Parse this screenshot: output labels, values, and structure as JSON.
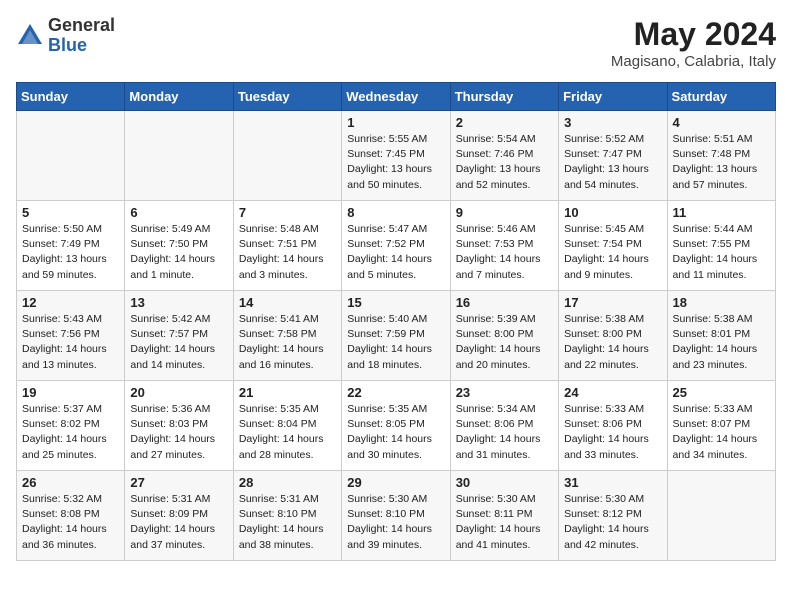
{
  "header": {
    "logo": {
      "text_general": "General",
      "text_blue": "Blue"
    },
    "title": "May 2024",
    "location": "Magisano, Calabria, Italy"
  },
  "calendar": {
    "weekdays": [
      "Sunday",
      "Monday",
      "Tuesday",
      "Wednesday",
      "Thursday",
      "Friday",
      "Saturday"
    ],
    "weeks": [
      [
        {
          "day": "",
          "sunrise": "",
          "sunset": "",
          "daylight": ""
        },
        {
          "day": "",
          "sunrise": "",
          "sunset": "",
          "daylight": ""
        },
        {
          "day": "",
          "sunrise": "",
          "sunset": "",
          "daylight": ""
        },
        {
          "day": "1",
          "sunrise": "Sunrise: 5:55 AM",
          "sunset": "Sunset: 7:45 PM",
          "daylight": "Daylight: 13 hours and 50 minutes."
        },
        {
          "day": "2",
          "sunrise": "Sunrise: 5:54 AM",
          "sunset": "Sunset: 7:46 PM",
          "daylight": "Daylight: 13 hours and 52 minutes."
        },
        {
          "day": "3",
          "sunrise": "Sunrise: 5:52 AM",
          "sunset": "Sunset: 7:47 PM",
          "daylight": "Daylight: 13 hours and 54 minutes."
        },
        {
          "day": "4",
          "sunrise": "Sunrise: 5:51 AM",
          "sunset": "Sunset: 7:48 PM",
          "daylight": "Daylight: 13 hours and 57 minutes."
        }
      ],
      [
        {
          "day": "5",
          "sunrise": "Sunrise: 5:50 AM",
          "sunset": "Sunset: 7:49 PM",
          "daylight": "Daylight: 13 hours and 59 minutes."
        },
        {
          "day": "6",
          "sunrise": "Sunrise: 5:49 AM",
          "sunset": "Sunset: 7:50 PM",
          "daylight": "Daylight: 14 hours and 1 minute."
        },
        {
          "day": "7",
          "sunrise": "Sunrise: 5:48 AM",
          "sunset": "Sunset: 7:51 PM",
          "daylight": "Daylight: 14 hours and 3 minutes."
        },
        {
          "day": "8",
          "sunrise": "Sunrise: 5:47 AM",
          "sunset": "Sunset: 7:52 PM",
          "daylight": "Daylight: 14 hours and 5 minutes."
        },
        {
          "day": "9",
          "sunrise": "Sunrise: 5:46 AM",
          "sunset": "Sunset: 7:53 PM",
          "daylight": "Daylight: 14 hours and 7 minutes."
        },
        {
          "day": "10",
          "sunrise": "Sunrise: 5:45 AM",
          "sunset": "Sunset: 7:54 PM",
          "daylight": "Daylight: 14 hours and 9 minutes."
        },
        {
          "day": "11",
          "sunrise": "Sunrise: 5:44 AM",
          "sunset": "Sunset: 7:55 PM",
          "daylight": "Daylight: 14 hours and 11 minutes."
        }
      ],
      [
        {
          "day": "12",
          "sunrise": "Sunrise: 5:43 AM",
          "sunset": "Sunset: 7:56 PM",
          "daylight": "Daylight: 14 hours and 13 minutes."
        },
        {
          "day": "13",
          "sunrise": "Sunrise: 5:42 AM",
          "sunset": "Sunset: 7:57 PM",
          "daylight": "Daylight: 14 hours and 14 minutes."
        },
        {
          "day": "14",
          "sunrise": "Sunrise: 5:41 AM",
          "sunset": "Sunset: 7:58 PM",
          "daylight": "Daylight: 14 hours and 16 minutes."
        },
        {
          "day": "15",
          "sunrise": "Sunrise: 5:40 AM",
          "sunset": "Sunset: 7:59 PM",
          "daylight": "Daylight: 14 hours and 18 minutes."
        },
        {
          "day": "16",
          "sunrise": "Sunrise: 5:39 AM",
          "sunset": "Sunset: 8:00 PM",
          "daylight": "Daylight: 14 hours and 20 minutes."
        },
        {
          "day": "17",
          "sunrise": "Sunrise: 5:38 AM",
          "sunset": "Sunset: 8:00 PM",
          "daylight": "Daylight: 14 hours and 22 minutes."
        },
        {
          "day": "18",
          "sunrise": "Sunrise: 5:38 AM",
          "sunset": "Sunset: 8:01 PM",
          "daylight": "Daylight: 14 hours and 23 minutes."
        }
      ],
      [
        {
          "day": "19",
          "sunrise": "Sunrise: 5:37 AM",
          "sunset": "Sunset: 8:02 PM",
          "daylight": "Daylight: 14 hours and 25 minutes."
        },
        {
          "day": "20",
          "sunrise": "Sunrise: 5:36 AM",
          "sunset": "Sunset: 8:03 PM",
          "daylight": "Daylight: 14 hours and 27 minutes."
        },
        {
          "day": "21",
          "sunrise": "Sunrise: 5:35 AM",
          "sunset": "Sunset: 8:04 PM",
          "daylight": "Daylight: 14 hours and 28 minutes."
        },
        {
          "day": "22",
          "sunrise": "Sunrise: 5:35 AM",
          "sunset": "Sunset: 8:05 PM",
          "daylight": "Daylight: 14 hours and 30 minutes."
        },
        {
          "day": "23",
          "sunrise": "Sunrise: 5:34 AM",
          "sunset": "Sunset: 8:06 PM",
          "daylight": "Daylight: 14 hours and 31 minutes."
        },
        {
          "day": "24",
          "sunrise": "Sunrise: 5:33 AM",
          "sunset": "Sunset: 8:06 PM",
          "daylight": "Daylight: 14 hours and 33 minutes."
        },
        {
          "day": "25",
          "sunrise": "Sunrise: 5:33 AM",
          "sunset": "Sunset: 8:07 PM",
          "daylight": "Daylight: 14 hours and 34 minutes."
        }
      ],
      [
        {
          "day": "26",
          "sunrise": "Sunrise: 5:32 AM",
          "sunset": "Sunset: 8:08 PM",
          "daylight": "Daylight: 14 hours and 36 minutes."
        },
        {
          "day": "27",
          "sunrise": "Sunrise: 5:31 AM",
          "sunset": "Sunset: 8:09 PM",
          "daylight": "Daylight: 14 hours and 37 minutes."
        },
        {
          "day": "28",
          "sunrise": "Sunrise: 5:31 AM",
          "sunset": "Sunset: 8:10 PM",
          "daylight": "Daylight: 14 hours and 38 minutes."
        },
        {
          "day": "29",
          "sunrise": "Sunrise: 5:30 AM",
          "sunset": "Sunset: 8:10 PM",
          "daylight": "Daylight: 14 hours and 39 minutes."
        },
        {
          "day": "30",
          "sunrise": "Sunrise: 5:30 AM",
          "sunset": "Sunset: 8:11 PM",
          "daylight": "Daylight: 14 hours and 41 minutes."
        },
        {
          "day": "31",
          "sunrise": "Sunrise: 5:30 AM",
          "sunset": "Sunset: 8:12 PM",
          "daylight": "Daylight: 14 hours and 42 minutes."
        },
        {
          "day": "",
          "sunrise": "",
          "sunset": "",
          "daylight": ""
        }
      ]
    ]
  }
}
